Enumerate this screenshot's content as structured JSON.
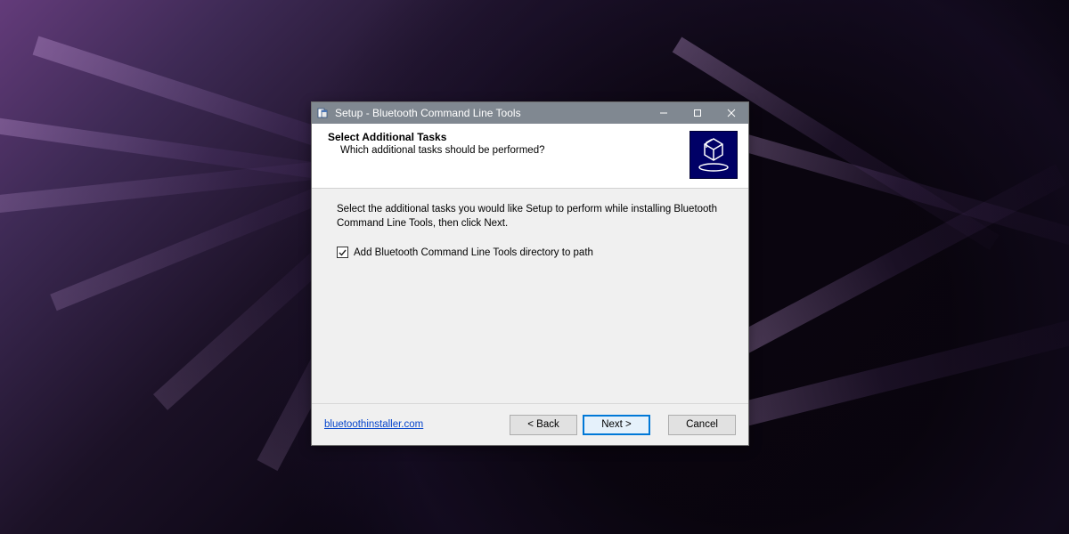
{
  "titlebar": {
    "title": "Setup - Bluetooth Command Line Tools"
  },
  "header": {
    "heading": "Select Additional Tasks",
    "subheading": "Which additional tasks should be performed?"
  },
  "body": {
    "description": "Select the additional tasks you would like Setup to perform while installing Bluetooth Command Line Tools, then click Next.",
    "checkbox_label": "Add Bluetooth Command Line Tools directory to path",
    "checkbox_checked": true
  },
  "footer": {
    "link_label": "bluetoothinstaller.com",
    "back_label": "< Back",
    "next_label": "Next >",
    "cancel_label": "Cancel"
  }
}
